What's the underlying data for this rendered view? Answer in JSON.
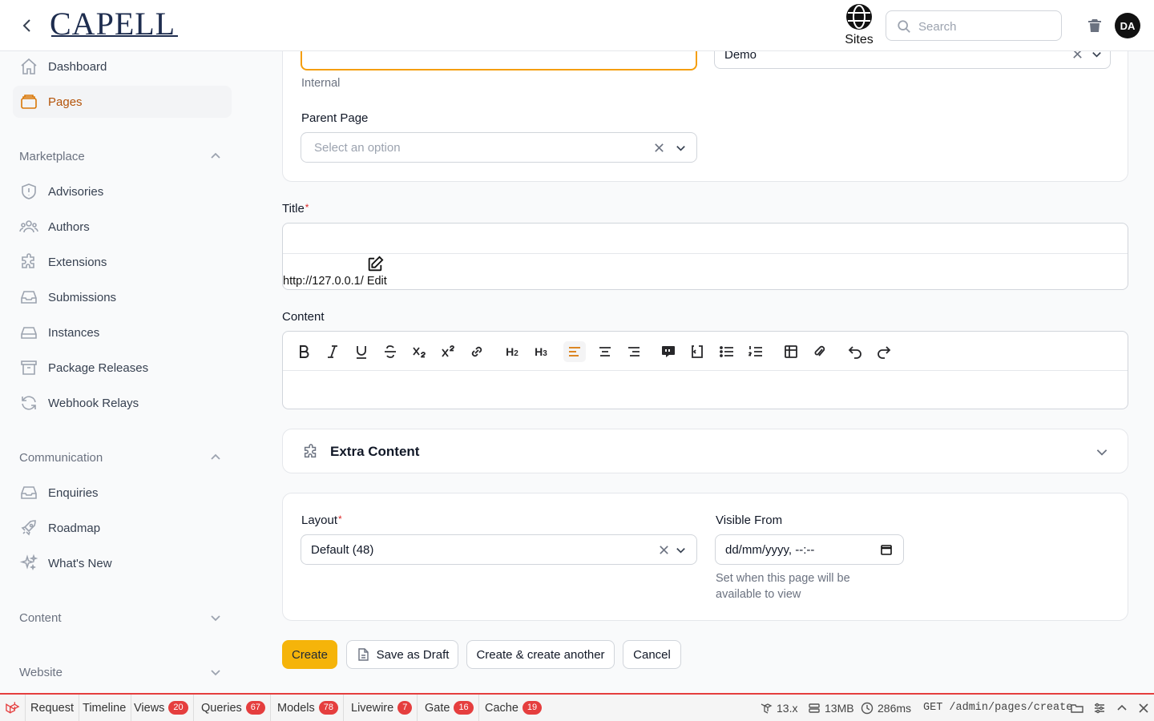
{
  "header": {
    "logo_text": "CAPELL",
    "sites_label": "Sites",
    "search_placeholder": "Search",
    "avatar_initials": "DA"
  },
  "sidebar": {
    "items": [
      {
        "label": "Dashboard",
        "icon": "home-icon"
      },
      {
        "label": "Pages",
        "icon": "layers-icon",
        "active": true
      }
    ],
    "groups": [
      {
        "label": "Marketplace",
        "expanded": true,
        "items": [
          "Advisories",
          "Authors",
          "Extensions",
          "Submissions",
          "Instances",
          "Package Releases",
          "Webhook Relays"
        ]
      },
      {
        "label": "Communication",
        "expanded": true,
        "items": [
          "Enquiries",
          "Roadmap",
          "What's New"
        ]
      },
      {
        "label": "Content",
        "expanded": false
      },
      {
        "label": "Website",
        "expanded": false
      }
    ]
  },
  "form": {
    "internal_helper": "Internal",
    "site_value": "Demo",
    "parent_page_label": "Parent Page",
    "parent_page_placeholder": "Select an option",
    "title_label": "Title",
    "permalink_base": "http://127.0.0.1/",
    "permalink_edit": "Edit",
    "content_label": "Content",
    "extra_content_label": "Extra Content",
    "layout_label": "Layout",
    "layout_value": "Default (48)",
    "visible_from_label": "Visible From",
    "visible_from_placeholder": "dd/mm/yyyy, --:--",
    "visible_from_helper": "Set when this page will be available to view"
  },
  "actions": {
    "create": "Create",
    "save_draft": "Save as Draft",
    "create_another": "Create & create another",
    "cancel": "Cancel"
  },
  "debugbar": {
    "tabs": [
      {
        "label": "Request"
      },
      {
        "label": "Timeline"
      },
      {
        "label": "Views",
        "count": "20"
      },
      {
        "label": "Queries",
        "count": "67"
      },
      {
        "label": "Models",
        "count": "78"
      },
      {
        "label": "Livewire",
        "count": "7"
      },
      {
        "label": "Gate",
        "count": "16"
      },
      {
        "label": "Cache",
        "count": "19"
      }
    ],
    "version": "13.x",
    "memory": "13MB",
    "time": "286ms",
    "route": "GET /admin/pages/create"
  },
  "colors": {
    "accent": "#d97706",
    "primary_button": "#f5b40a",
    "debug_red": "#e53e3e"
  }
}
